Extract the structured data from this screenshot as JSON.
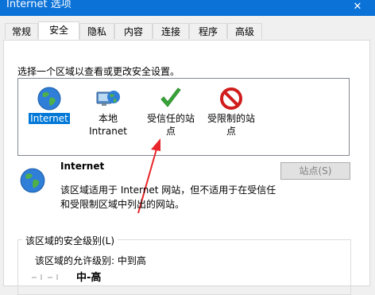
{
  "window": {
    "title": "Internet 选项",
    "close_glyph": "✕"
  },
  "tabs": [
    {
      "label": "常规",
      "active": false
    },
    {
      "label": "安全",
      "active": true
    },
    {
      "label": "隐私",
      "active": false
    },
    {
      "label": "内容",
      "active": false
    },
    {
      "label": "连接",
      "active": false
    },
    {
      "label": "程序",
      "active": false
    },
    {
      "label": "高级",
      "active": false
    }
  ],
  "security": {
    "instruction": "选择一个区域以查看或更改安全设置。",
    "zones": [
      {
        "label_line1": "Internet",
        "label_line2": "",
        "icon": "globe-icon",
        "selected": true
      },
      {
        "label_line1": "本地",
        "label_line2": "Intranet",
        "icon": "intranet-icon",
        "selected": false
      },
      {
        "label_line1": "受信任的站",
        "label_line2": "点",
        "icon": "checkmark-icon",
        "selected": false
      },
      {
        "label_line1": "受限制的站",
        "label_line2": "点",
        "icon": "restricted-icon",
        "selected": false
      }
    ],
    "selected_zone": {
      "name": "Internet",
      "description_line1": "该区域适用于 Internet 网站，但不适用于在受信任",
      "description_line2": "和受限制区域中列出的网站。"
    },
    "sites_button": "站点(S)",
    "level_group_title": "该区域的安全级别(L)",
    "allowed_levels": "该区域的允许级别: 中到高",
    "current_level": "中-高"
  },
  "colors": {
    "titlebar": "#0b72d8",
    "selection": "#0078d7",
    "annotation_arrow": "#e8252a",
    "check_green": "#3aa53a",
    "restricted_red": "#d01c1c"
  }
}
